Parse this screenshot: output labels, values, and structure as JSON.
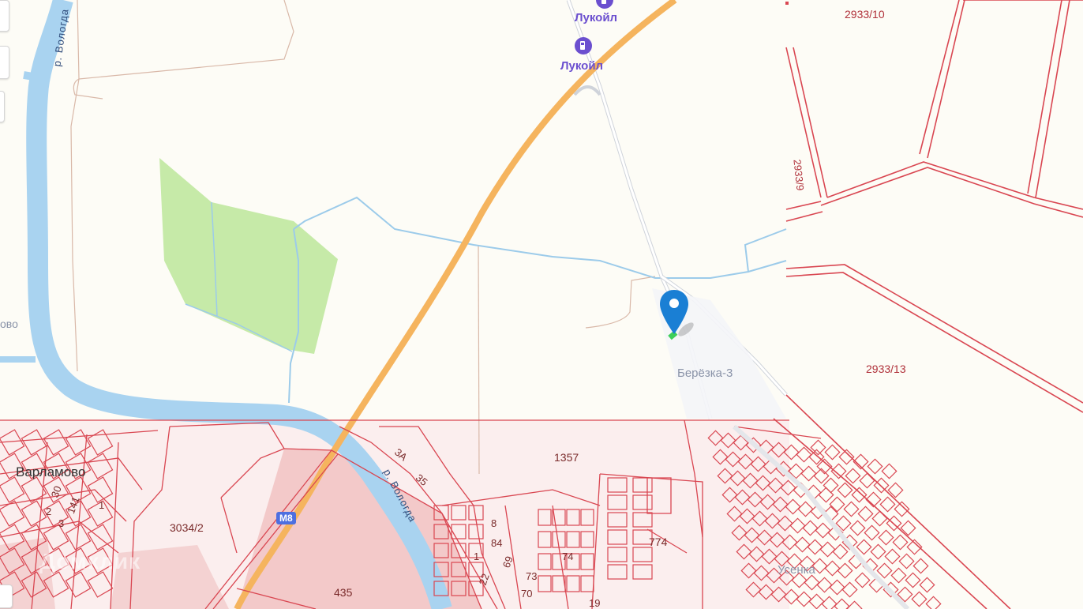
{
  "map": {
    "poi": [
      {
        "id": "lukoil-1",
        "name": "Лукойл",
        "icon": "fuel-icon"
      },
      {
        "id": "lukoil-2",
        "name": "Лукойл",
        "icon": "fuel-icon"
      }
    ],
    "places": {
      "varlamovo": "Варламово",
      "beryozka": "Берёзка-3",
      "partial_left": "ово",
      "usenka": "Усенка"
    },
    "rivers": {
      "upper": "р. Вологда",
      "lower": "р. Вологда"
    },
    "road_badge": "М8",
    "cadastre": {
      "p2933_10": "2933/10",
      "p2933_9": "2933/9",
      "p2933_13": "2933/13",
      "p1357": "1357",
      "p3034_2": "3034/2",
      "p774": "774",
      "p435": "435",
      "p3a": "3А",
      "p35": "35",
      "p30": "30",
      "p2": "2",
      "p141": "141",
      "p1": "1",
      "p3": "3",
      "p8": "8",
      "p84": "84",
      "p69": "69",
      "p74": "74",
      "p73": "73",
      "p70": "70",
      "p22": "22",
      "p1b": "1",
      "p19": "19"
    },
    "watermark": "Домклик",
    "colors": {
      "background": "#fdfcf6",
      "river": "#a9d3f0",
      "stream": "#8ec2e8",
      "highway": "#f5b45e",
      "forest": "#c6eaa8",
      "parcel_line": "#d94651",
      "industrial": "#f3c9c9",
      "marker": "#1a7fd4"
    }
  }
}
